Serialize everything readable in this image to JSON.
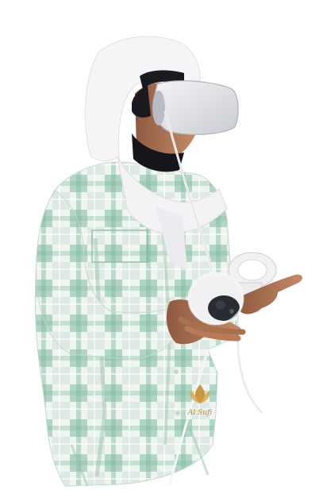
{
  "image": {
    "background_color": "#ffffff",
    "subject": {
      "jacket_base": "#dfe9e3",
      "jacket_check_light": "#eef4f0",
      "jacket_check_mint": "#a8d1bd",
      "jacket_check_deep": "#7fbaa0",
      "headset_body": "#e6e6ea",
      "headset_shadow": "#b9bcc4",
      "headset_strap": "#1a1a1f",
      "skin": "#b77b5a",
      "skin_shadow": "#8e5a3f",
      "scarf": "#f3f3f5",
      "mask": "#16161a",
      "controller_body": "#f1f1f3",
      "controller_face": "#2a2c33",
      "cable": "#f5f5f7"
    },
    "watermark": {
      "text": "Al Sufi",
      "color": "#c98d2e"
    }
  }
}
